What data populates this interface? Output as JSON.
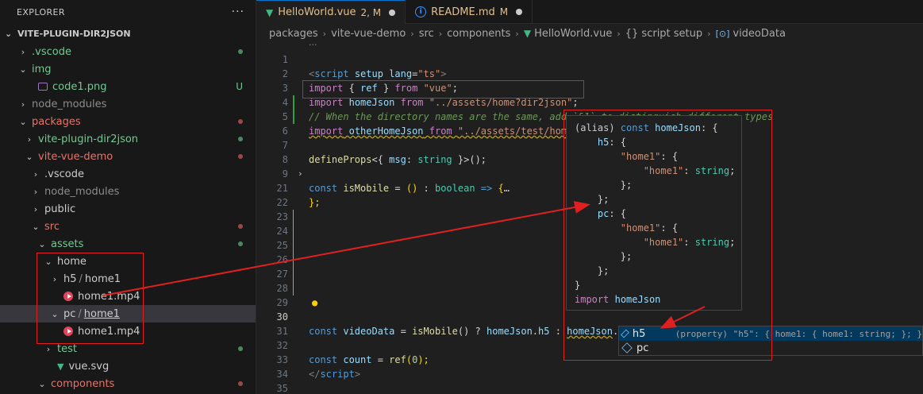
{
  "sidebar": {
    "title": "EXPLORER",
    "more": "···",
    "root": "VITE-PLUGIN-DIR2JSON",
    "items": [
      {
        "label": ".vscode",
        "indent": 1,
        "chev": "›",
        "color": "green",
        "status": "dot-green"
      },
      {
        "label": "img",
        "indent": 1,
        "chev": "⌄",
        "color": "green",
        "status": ""
      },
      {
        "label": "code1.png",
        "indent": 2,
        "chev": "",
        "color": "green",
        "status": "U",
        "icon": "png"
      },
      {
        "label": "node_modules",
        "indent": 1,
        "chev": "›",
        "color": "gray",
        "status": ""
      },
      {
        "label": "packages",
        "indent": 1,
        "chev": "⌄",
        "color": "red",
        "status": "dot-red"
      },
      {
        "label": "vite-plugin-dir2json",
        "indent": 2,
        "chev": "›",
        "color": "green",
        "status": "dot-green"
      },
      {
        "label": "vite-vue-demo",
        "indent": 2,
        "chev": "⌄",
        "color": "red",
        "status": "dot-red"
      },
      {
        "label": ".vscode",
        "indent": 3,
        "chev": "›",
        "color": "white",
        "status": ""
      },
      {
        "label": "node_modules",
        "indent": 3,
        "chev": "›",
        "color": "gray",
        "status": ""
      },
      {
        "label": "public",
        "indent": 3,
        "chev": "›",
        "color": "white",
        "status": ""
      },
      {
        "label": "src",
        "indent": 3,
        "chev": "⌄",
        "color": "red",
        "status": "dot-red"
      },
      {
        "label": "assets",
        "indent": 4,
        "chev": "⌄",
        "color": "green",
        "status": "dot-green"
      },
      {
        "label": "home",
        "indent": 5,
        "chev": "⌄",
        "color": "white",
        "status": ""
      },
      {
        "label": "h5 / home1",
        "indent": 6,
        "chev": "›",
        "color": "white",
        "status": ""
      },
      {
        "label": "home1.mp4",
        "indent": 6,
        "chev": "",
        "color": "white",
        "status": "",
        "icon": "mp4"
      },
      {
        "label": "pc / home1",
        "indent": 6,
        "chev": "⌄",
        "color": "white",
        "status": "",
        "selected": true
      },
      {
        "label": "home1.mp4",
        "indent": 6,
        "chev": "",
        "color": "white",
        "status": "",
        "icon": "mp4"
      },
      {
        "label": "test",
        "indent": 5,
        "chev": "›",
        "color": "green",
        "status": "dot-green"
      },
      {
        "label": "vue.svg",
        "indent": 5,
        "chev": "",
        "color": "white",
        "status": "",
        "icon": "vue"
      },
      {
        "label": "components",
        "indent": 4,
        "chev": "⌄",
        "color": "red",
        "status": "dot-red"
      }
    ]
  },
  "tabs": [
    {
      "name": "HelloWorld.vue",
      "status": "2, M",
      "active": true
    },
    {
      "name": "README.md",
      "status": "M",
      "active": false
    }
  ],
  "breadcrumb": {
    "parts": [
      "packages",
      "vite-vue-demo",
      "src",
      "components",
      "HelloWorld.vue",
      "{} script setup",
      "videoData"
    ],
    "ellipsis": "···"
  },
  "editor": {
    "lines": [
      {
        "n": "1"
      },
      {
        "n": "2"
      },
      {
        "n": "3"
      },
      {
        "n": "4"
      },
      {
        "n": "5"
      },
      {
        "n": "6"
      },
      {
        "n": "7"
      },
      {
        "n": "8"
      },
      {
        "n": "9"
      },
      {
        "n": "21"
      },
      {
        "n": "22"
      },
      {
        "n": "23"
      },
      {
        "n": "24"
      },
      {
        "n": "25"
      },
      {
        "n": "26"
      },
      {
        "n": "27"
      },
      {
        "n": "28"
      },
      {
        "n": "29"
      },
      {
        "n": "30"
      },
      {
        "n": "31"
      },
      {
        "n": "32"
      },
      {
        "n": "33"
      },
      {
        "n": "34"
      },
      {
        "n": "35"
      }
    ],
    "code": {
      "l1": [
        "<",
        "script",
        " ",
        "setup",
        " ",
        "lang",
        "=",
        "\"ts\"",
        ">"
      ],
      "l2": [
        "import",
        " { ",
        "ref",
        " } ",
        "from",
        " ",
        "\"vue\"",
        ";"
      ],
      "l3": [
        "import",
        " ",
        "homeJson",
        " ",
        "from",
        " ",
        "\"../assets/home?dir2json\"",
        ";"
      ],
      "l4": "// When the directory names are the same, add `&1` to distinguish different types",
      "l5": [
        "import",
        " ",
        "otherHomeJson",
        " ",
        "from",
        " ",
        "\"../assets/test/home?dir2json&1\""
      ],
      "l7": [
        "defineProps",
        "<{ ",
        "msg",
        ": ",
        "string",
        " }>();"
      ],
      "l9": [
        "const",
        " ",
        "isMobile",
        " = ",
        "()",
        " : ",
        "boolean",
        " => ",
        "{",
        "…"
      ],
      "l21": "};",
      "l30": [
        "const",
        " ",
        "videoData",
        " = ",
        "isMobile",
        "() ? ",
        "homeJson",
        ".",
        "h5",
        " : ",
        "homeJson",
        "."
      ],
      "l32": [
        "const",
        " ",
        "count",
        " = ",
        "ref",
        "(",
        "0",
        ");"
      ],
      "l33": [
        "</",
        "script",
        ">"
      ],
      "l35": [
        "<",
        "template",
        ">"
      ]
    }
  },
  "hover": {
    "lines": [
      [
        "(alias) ",
        "const",
        " ",
        "homeJson",
        ": {"
      ],
      [
        "    ",
        "h5",
        ": {"
      ],
      [
        "        ",
        "\"home1\"",
        ": {"
      ],
      [
        "            ",
        "\"home1\"",
        ": ",
        "string",
        ";"
      ],
      [
        "        ",
        "};"
      ],
      [
        "    ",
        "};"
      ],
      [
        "    ",
        "pc",
        ": {"
      ],
      [
        "        ",
        "\"home1\"",
        ": {"
      ],
      [
        "            ",
        "\"home1\"",
        ": ",
        "string",
        ";"
      ],
      [
        "        ",
        "};"
      ],
      [
        "    ",
        "};"
      ],
      [
        "",
        "}"
      ],
      [
        "import",
        " ",
        "homeJson"
      ]
    ]
  },
  "suggest": {
    "items": [
      {
        "label": "h5",
        "detail": "(property) \"h5\": { home1: { home1: string; }; }"
      },
      {
        "label": "pc",
        "detail": ""
      }
    ]
  },
  "colors": {
    "annotation": "#e02020",
    "accent": "#0078d4"
  }
}
